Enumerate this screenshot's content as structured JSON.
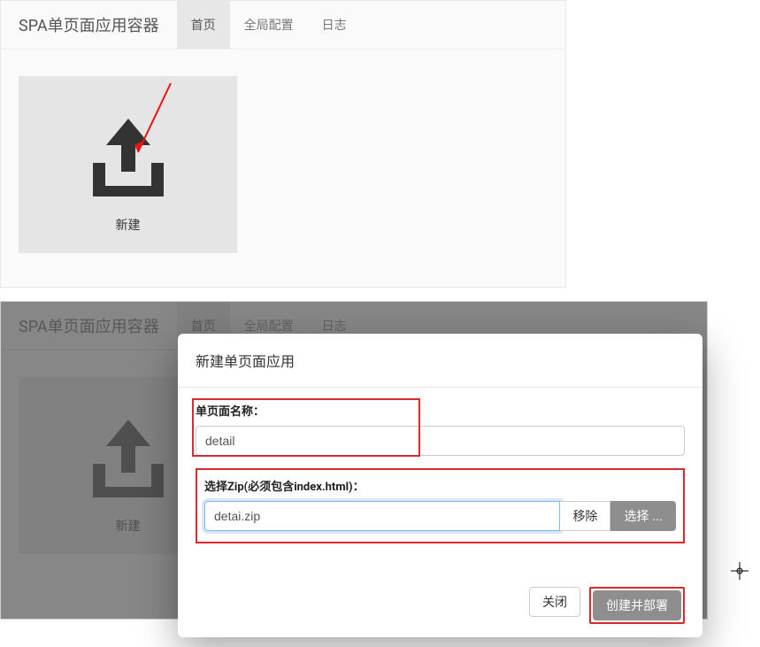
{
  "app": {
    "brand": "SPA单页面应用容器",
    "nav": {
      "home": "首页",
      "global_config": "全局配置",
      "log": "日志"
    }
  },
  "card": {
    "new_label": "新建"
  },
  "modal": {
    "title": "新建单页面应用",
    "name_label": "单页面名称：",
    "name_value": "detail",
    "zip_label": "选择Zip(必须包含index.html)：",
    "zip_value": "detai.zip",
    "remove_btn": "移除",
    "select_btn": "选择 ...",
    "close_btn": "关闭",
    "deploy_btn": "创建并部署"
  },
  "colors": {
    "highlight_red": "#d92b2b",
    "button_gray": "#8e8e8e"
  }
}
